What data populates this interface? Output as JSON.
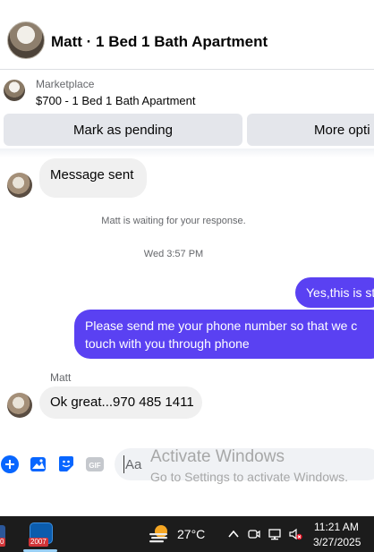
{
  "header": {
    "title": "Matt · 1 Bed 1 Bath Apartment"
  },
  "marketplace": {
    "label": "Marketplace",
    "item": "$700 - 1 Bed 1 Bath Apartment",
    "mark_pending_label": "Mark as pending",
    "more_options_label": "More opti"
  },
  "messages": {
    "sent_notice": "Message sent",
    "waiting_notice": "Matt is waiting for your response.",
    "timestamp": "Wed 3:57 PM",
    "out_1": "Yes,this is st",
    "out_2_line1": "Please send me your phone  number so that we c",
    "out_2_line2": "touch with you through phone",
    "sender": "Matt",
    "in_1": "Ok great...970 485 1411"
  },
  "composer": {
    "placeholder": "Aa"
  },
  "watermark": {
    "title": "Activate Windows",
    "subtitle": "Go to Settings to activate Windows."
  },
  "taskbar": {
    "badge_left": "0",
    "badge_app": "2007",
    "temperature": "27°C",
    "time": "11:21 AM",
    "date": "3/27/2025"
  },
  "colors": {
    "outgoing_bubble": "#5a41f2",
    "accent_icons": "#0866ff"
  }
}
